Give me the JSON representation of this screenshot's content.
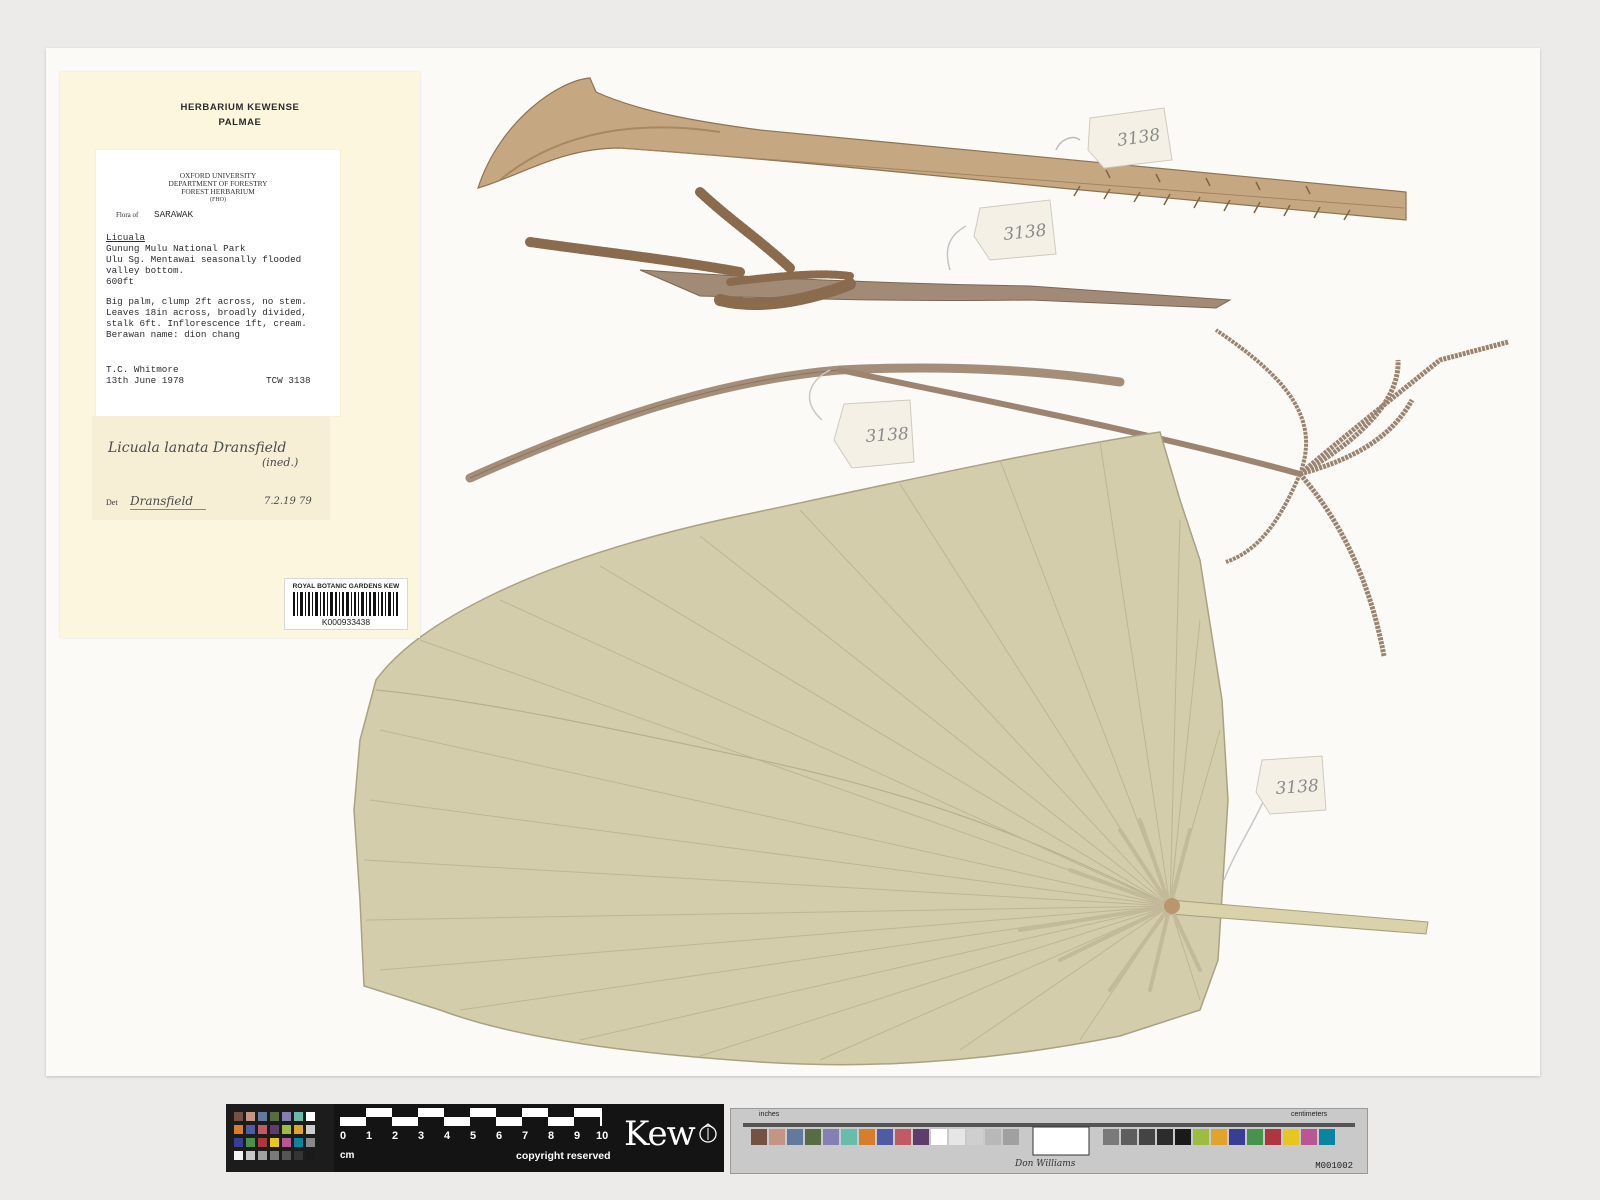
{
  "kew_label": {
    "line1": "HERBARIUM KEWENSE",
    "line2": "PALMAE"
  },
  "oxford_label": {
    "heading1": "OXFORD UNIVERSITY",
    "heading2": "DEPARTMENT OF FORESTRY",
    "heading3": "FOREST HERBARIUM",
    "heading4": "(FHO)",
    "flora_of": "Flora of",
    "region": "SARAWAK",
    "genus": "Licuala",
    "locality1": "Gunung Mulu National Park",
    "locality2": "Ulu  Sg. Mentawai  seasonally flooded",
    "locality3": "valley bottom.",
    "altitude": "600ft",
    "note1": "Big palm, clump 2ft across, no stem.",
    "note2": "Leaves 18in across, broadly divided,",
    "note3": "stalk 6ft.  Inflorescence 1ft, cream.",
    "note4": "Berawan name:  dion chang",
    "collector": "T.C. Whitmore",
    "date": "13th June 1978",
    "number": "TCW 3138"
  },
  "determination": {
    "name": "Licuala lanata Dransfield",
    "ined": "(ined.)",
    "det_prefix": "Det",
    "det_by": "Dransfield",
    "det_date": "7.2.19 79"
  },
  "barcode": {
    "institution": "ROYAL BOTANIC GARDENS KEW",
    "number": "K000933438"
  },
  "tags": {
    "tag1": "3138",
    "tag2": "3138",
    "tag3": "3138",
    "tag4": "3138"
  },
  "ruler": {
    "digits": [
      "0",
      "1",
      "2",
      "3",
      "4",
      "5",
      "6",
      "7",
      "8",
      "9",
      "10"
    ],
    "unit": "cm",
    "brand": "Kew",
    "copyright": "copyright reserved"
  },
  "target_card": {
    "inches": "inches",
    "centimeters": "centimeters",
    "signature": "Don Williams",
    "code": "M001002"
  },
  "colors": {
    "sheet": "#fbfaf6",
    "leaf": "#d2ccaa",
    "stalk": "#b39a74",
    "label": "#fbf6dd"
  }
}
